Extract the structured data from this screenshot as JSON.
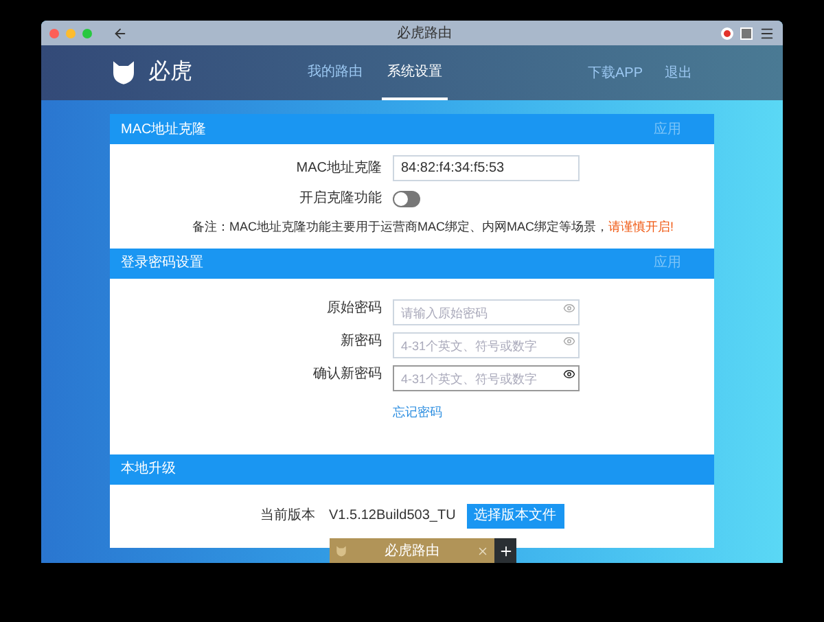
{
  "window": {
    "title": "必虎路由"
  },
  "header": {
    "brand": "必虎",
    "nav": [
      {
        "label": "我的路由",
        "selected": false
      },
      {
        "label": "系统设置",
        "selected": true
      }
    ],
    "links": [
      "下载APP",
      "退出"
    ]
  },
  "mac_section": {
    "title": "MAC地址克隆",
    "apply": "应用",
    "mac_label": "MAC地址克隆",
    "mac_value": "84:82:f4:34:f5:53",
    "toggle_label": "开启克隆功能",
    "toggle_on": false,
    "note": "备注：MAC地址克隆功能主要用于运营商MAC绑定、内网MAC绑定等场景，",
    "warning": "请谨慎开启!"
  },
  "password_section": {
    "title": "登录密码设置",
    "apply": "应用",
    "fields": [
      {
        "label": "原始密码",
        "placeholder": "请输入原始密码",
        "focused": false
      },
      {
        "label": "新密码",
        "placeholder": "4-31个英文、符号或数字",
        "focused": false
      },
      {
        "label": "确认新密码",
        "placeholder": "4-31个英文、符号或数字",
        "focused": true
      }
    ],
    "forgot": "忘记密码"
  },
  "upgrade_section": {
    "title": "本地升级",
    "version_label": "当前版本",
    "version": "V1.5.12Build503_TU",
    "button": "选择版本文件"
  },
  "tab_bar": {
    "tab": "必虎路由"
  }
}
